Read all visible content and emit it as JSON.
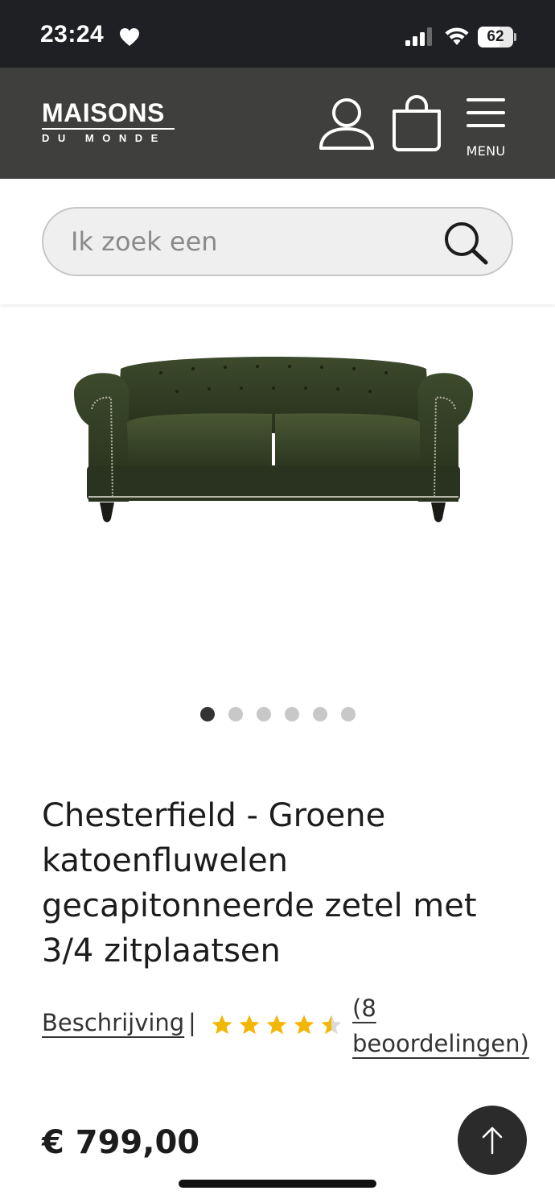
{
  "status_bar": {
    "time": "23:24",
    "battery_level": "62",
    "icons": [
      "heart-icon",
      "cellular-signal-icon",
      "wifi-icon",
      "battery-icon"
    ]
  },
  "header": {
    "logo_top": "MAISONS",
    "logo_bottom": "DU MONDE",
    "menu_label": "MENU",
    "icons": [
      "user-account-icon",
      "shopping-bag-icon",
      "hamburger-menu-icon"
    ],
    "colors": {
      "background": "#3f3f3d",
      "foreground": "#ffffff"
    }
  },
  "search": {
    "placeholder": "Ik zoek een",
    "value": "",
    "icon": "search-icon"
  },
  "gallery": {
    "image": "green velvet chesterfield sofa",
    "slide_count": 6,
    "active_index": 0
  },
  "product": {
    "title": "Chesterfield - Groene katoenfluwelen gecapitonneerde zetel met 3/4 zitplaatsen",
    "description_link": "Beschrijving",
    "separator": "|",
    "rating": 4.5,
    "rating_max": 5,
    "reviews_link": "(8 beoordelingen)",
    "price": "€ 799,00",
    "star_color": "#f2b705"
  },
  "scroll_top_button": {
    "icon": "arrow-up-icon"
  }
}
